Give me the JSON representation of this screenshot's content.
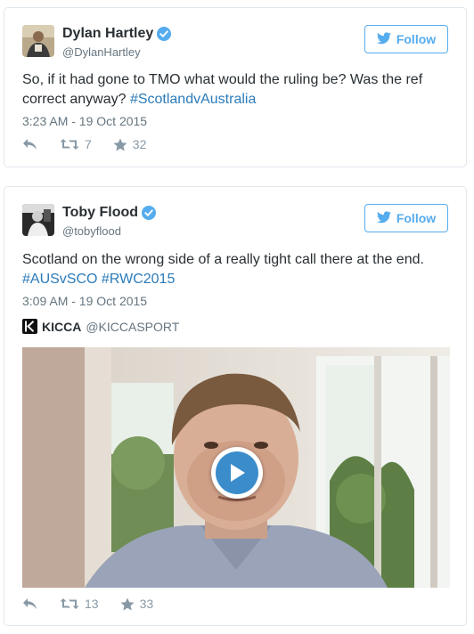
{
  "colors": {
    "accent": "#55acee",
    "hashtag": "#2b7bb9",
    "text": "#292f33",
    "muted": "#66757f",
    "icon": "#8899a6"
  },
  "tweets": [
    {
      "name": "Dylan Hartley",
      "handle": "@DylanHartley",
      "follow_label": "Follow",
      "text_parts": [
        "So, if it had gone to TMO what would the ruling be? Was the ref correct anyway? ",
        "#ScotlandvAustralia"
      ],
      "time": "3:23 AM - 19 Oct 2015",
      "retweets": "7",
      "likes": "32"
    },
    {
      "name": "Toby Flood",
      "handle": "@tobyflood",
      "follow_label": "Follow",
      "text_line1": "Scotland on the wrong side of a really tight call there at the end.",
      "hashtags": [
        "#AUSvSCO",
        "#RWC2015"
      ],
      "time": "3:09 AM - 19 Oct 2015",
      "card": {
        "brand": "KICCA",
        "handle": "@KICCASPORT"
      },
      "retweets": "13",
      "likes": "33"
    }
  ]
}
